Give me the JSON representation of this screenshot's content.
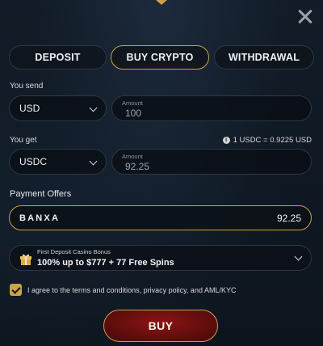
{
  "tabs": {
    "deposit": "DEPOSIT",
    "buy_crypto": "BUY CRYPTO",
    "withdrawal": "WITHDRAWAL",
    "active": "BUY CRYPTO"
  },
  "send": {
    "label": "You send",
    "currency": "USD",
    "amount_caption": "Amount",
    "amount_value": "100"
  },
  "get": {
    "label": "You get",
    "currency": "USDC",
    "amount_caption": "Amount",
    "amount_value": "92.25",
    "rate": "1 USDC = 0.9225 USD"
  },
  "offers": {
    "label": "Payment Offers",
    "provider": "BANXA",
    "price": "92.25"
  },
  "bonus": {
    "caption": "First Deposit Casino Bonus",
    "text": "100% up to $777 + 77 Free Spins"
  },
  "agreement": {
    "checked": true,
    "text": "I agree to the terms and conditions, privacy policy, and AML/KYC"
  },
  "buy_button": "BUY",
  "colors": {
    "gold_accent": "#c9a24a",
    "buy_red": "#8c1414",
    "background": "#121c28"
  },
  "icons": [
    "close-icon",
    "chevron-down-icon",
    "info-icon",
    "gift-icon",
    "check-icon"
  ]
}
